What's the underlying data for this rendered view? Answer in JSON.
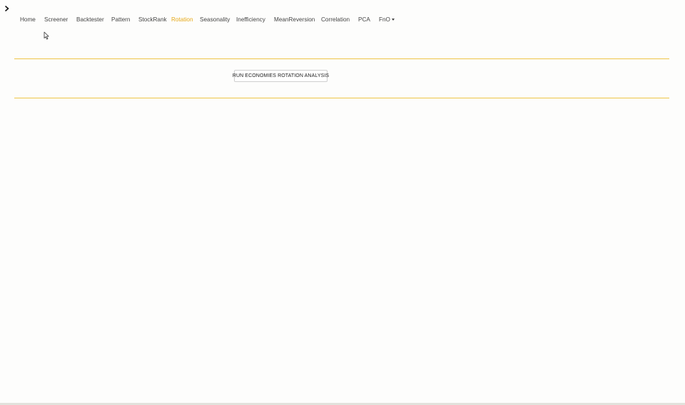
{
  "sidebar_toggle": {
    "icon": "chevron-right-icon"
  },
  "nav": {
    "items": [
      {
        "label": "Home",
        "active": false
      },
      {
        "label": "Screener",
        "active": false
      },
      {
        "label": "Backtester",
        "active": false
      },
      {
        "label": "Pattern",
        "active": false
      },
      {
        "label": "StockRank",
        "active": false
      },
      {
        "label": "Rotation",
        "active": true
      },
      {
        "label": "Seasonality",
        "active": false
      },
      {
        "label": "Inefficiency",
        "active": false
      },
      {
        "label": "MeanReversion",
        "active": false
      },
      {
        "label": "Correlation",
        "active": false
      },
      {
        "label": "PCA",
        "active": false
      },
      {
        "label": "FnO",
        "active": false,
        "dropdown": true
      }
    ]
  },
  "main": {
    "run_button_label": "RUN ECONOMIES ROTATION ANALYSIS"
  },
  "colors": {
    "accent": "#e6a817",
    "divider": "#efc546",
    "text": "#444444",
    "background": "#fdfdfc"
  }
}
